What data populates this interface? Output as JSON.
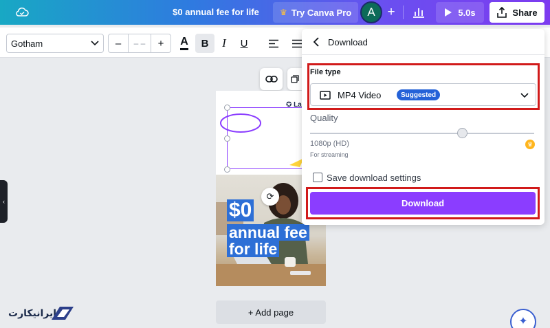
{
  "topbar": {
    "title": "$0 annual fee for life",
    "try_pro_label": "Try Canva Pro",
    "avatar_initial": "A",
    "play_duration": "5.0s",
    "share_label": "Share"
  },
  "toolbar": {
    "font_name": "Gotham",
    "font_size_value": "– –",
    "decrease_label": "–",
    "increase_label": "+",
    "text_color_label": "A",
    "bold_label": "B",
    "italic_label": "I",
    "underline_label": "U"
  },
  "canvas": {
    "headline_line1": "$0",
    "headline_line2": "annual fee",
    "headline_line3": "for life",
    "logo_text": "✪ La",
    "add_page_label": "+ Add page"
  },
  "download_panel": {
    "title": "Download",
    "file_type_label": "File type",
    "file_type_value": "MP4 Video",
    "suggested_badge": "Suggested",
    "quality_label": "Quality",
    "quality_value": "1080p (HD)",
    "quality_note": "For streaming",
    "quality_fraction": 0.68,
    "save_settings_label": "Save download settings",
    "save_settings_checked": false,
    "download_button_label": "Download"
  },
  "watermark": {
    "text": "ایرانیکارت"
  },
  "colors": {
    "accent_purple": "#8b3dff",
    "highlight_red": "#d11a1a",
    "badge_blue": "#2462d8",
    "crown_gold": "#ffb51d"
  },
  "icons": [
    "cloud-icon",
    "crown-icon",
    "plus-icon",
    "bar-chart-icon",
    "play-icon",
    "share-upload-icon",
    "chevron-down-icon",
    "text-color-icon",
    "align-left-icon",
    "link-icon",
    "duplicate-icon",
    "rotate-icon",
    "back-arrow-icon",
    "video-file-icon",
    "magic-sparkle-icon"
  ]
}
